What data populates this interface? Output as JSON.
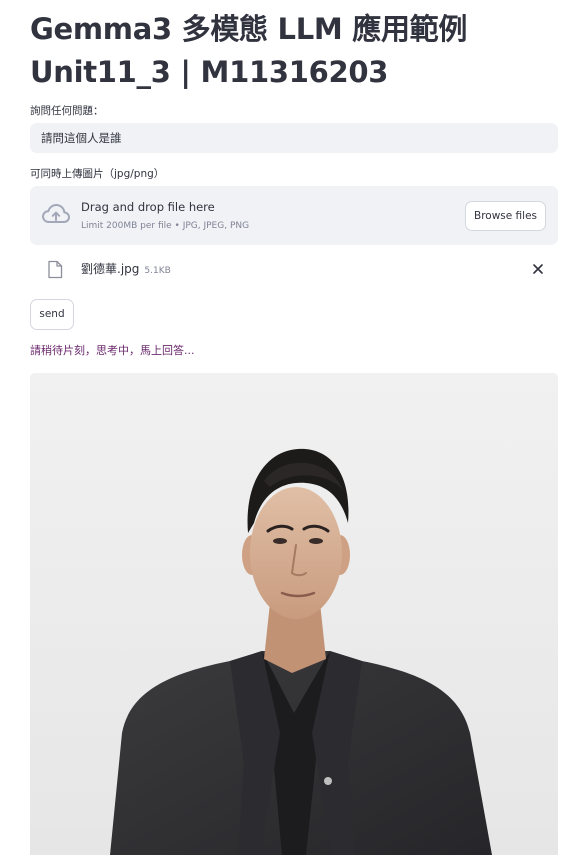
{
  "header": {
    "title_line1": "Gemma3 多模態 LLM 應用範例",
    "title_line2": "Unit11_3 | M11316203"
  },
  "question": {
    "label": "詢問任何問題：",
    "value": "請問這個人是誰"
  },
  "uploader": {
    "label": "可同時上傳圖片（jpg/png）",
    "drop_text": "Drag and drop file here",
    "limit_text": "Limit 200MB per file • JPG, JPEG, PNG",
    "browse_label": "Browse files",
    "icon": "cloud-upload-icon"
  },
  "uploaded_file": {
    "name": "劉德華.jpg",
    "size": "5.1KB",
    "icon": "file-icon",
    "remove_icon": "close-icon"
  },
  "actions": {
    "send_label": "send"
  },
  "status": {
    "text": "請稍待片刻，思考中，馬上回答..."
  },
  "colors": {
    "input_bg": "#f0f2f6",
    "text": "#31333f",
    "muted": "#808495",
    "status": "#6b2a6d"
  }
}
